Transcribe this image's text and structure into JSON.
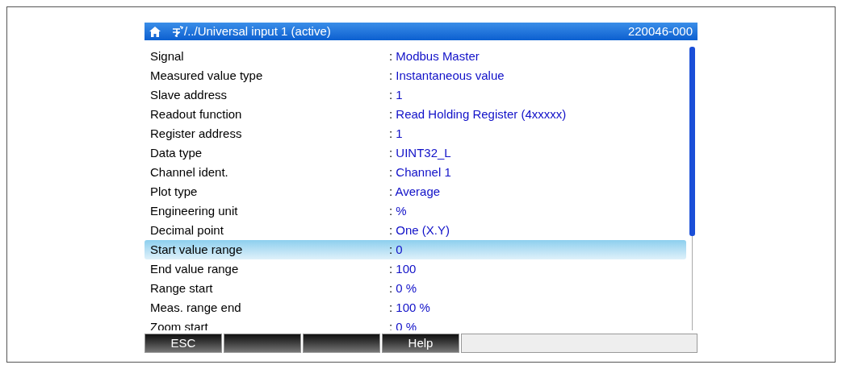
{
  "header": {
    "path": "/../Universal input 1 (active)",
    "id": "220046-000"
  },
  "rows": [
    {
      "label": "Signal",
      "sep": ":",
      "value": "Modbus Master",
      "selected": false
    },
    {
      "label": "Measured value type",
      "sep": ":",
      "value": "Instantaneous value",
      "selected": false
    },
    {
      "label": "Slave address",
      "sep": ":",
      "value": "1",
      "selected": false
    },
    {
      "label": "Readout function",
      "sep": ":",
      "value": "Read Holding Register (4xxxxx)",
      "selected": false
    },
    {
      "label": "Register address",
      "sep": ":",
      "value": "1",
      "selected": false
    },
    {
      "label": "Data type",
      "sep": ":",
      "value": "UINT32_L",
      "selected": false
    },
    {
      "label": "Channel ident.",
      "sep": ":",
      "value": "Channel 1",
      "selected": false
    },
    {
      "label": "Plot type",
      "sep": ":",
      "value": "Average",
      "selected": false
    },
    {
      "label": "Engineering unit",
      "sep": ":",
      "value": "%",
      "selected": false
    },
    {
      "label": "Decimal point",
      "sep": ":",
      "value": "One (X.Y)",
      "selected": false
    },
    {
      "label": "Start value range",
      "sep": ":",
      "value": "0",
      "selected": true
    },
    {
      "label": "End value range",
      "sep": ":",
      "value": "100",
      "selected": false
    },
    {
      "label": "Range start",
      "sep": ":",
      "value": "0 %",
      "selected": false
    },
    {
      "label": "Meas. range end",
      "sep": ":",
      "value": "100 %",
      "selected": false
    },
    {
      "label": "Zoom start",
      "sep": ":",
      "value": "0 %",
      "selected": false
    }
  ],
  "softkeys": [
    {
      "kind": "labeled",
      "label": "ESC"
    },
    {
      "kind": "blank"
    },
    {
      "kind": "blank"
    },
    {
      "kind": "labeled",
      "label": "Help"
    }
  ]
}
